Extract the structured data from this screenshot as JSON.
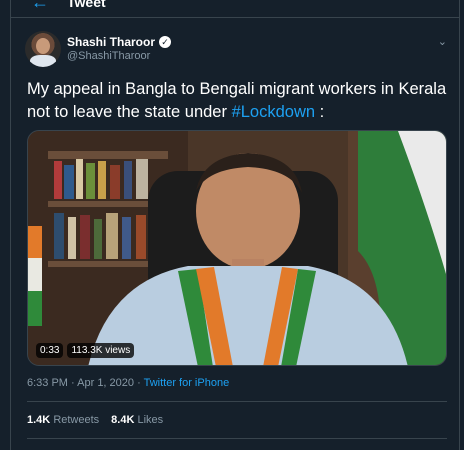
{
  "topbar": {
    "back_icon": "back-arrow-icon",
    "title": "Tweet"
  },
  "tweet": {
    "author_name": "Shashi Tharoor",
    "author_handle": "@ShashiTharoor",
    "text_main": "My appeal in Bangla to Bengali migrant workers in Kerala not to leave the state under ",
    "hashtag": "#Lockdown",
    "text_end": " :",
    "media": {
      "duration": "0:33",
      "views": "113.3K views"
    },
    "time": "6:33 PM",
    "separator": " · ",
    "date": "Apr 1, 2020",
    "source": "Twitter for iPhone",
    "retweets_count": "1.4K",
    "retweets_label": "Retweets",
    "likes_count": "8.4K",
    "likes_label": "Likes"
  },
  "colors": {
    "background": "#15202b",
    "accent": "#1da1f2",
    "muted": "#8899a6",
    "border": "#38444d"
  },
  "icons": {
    "verified": "verified-badge-icon",
    "more": "chevron-down-icon"
  }
}
